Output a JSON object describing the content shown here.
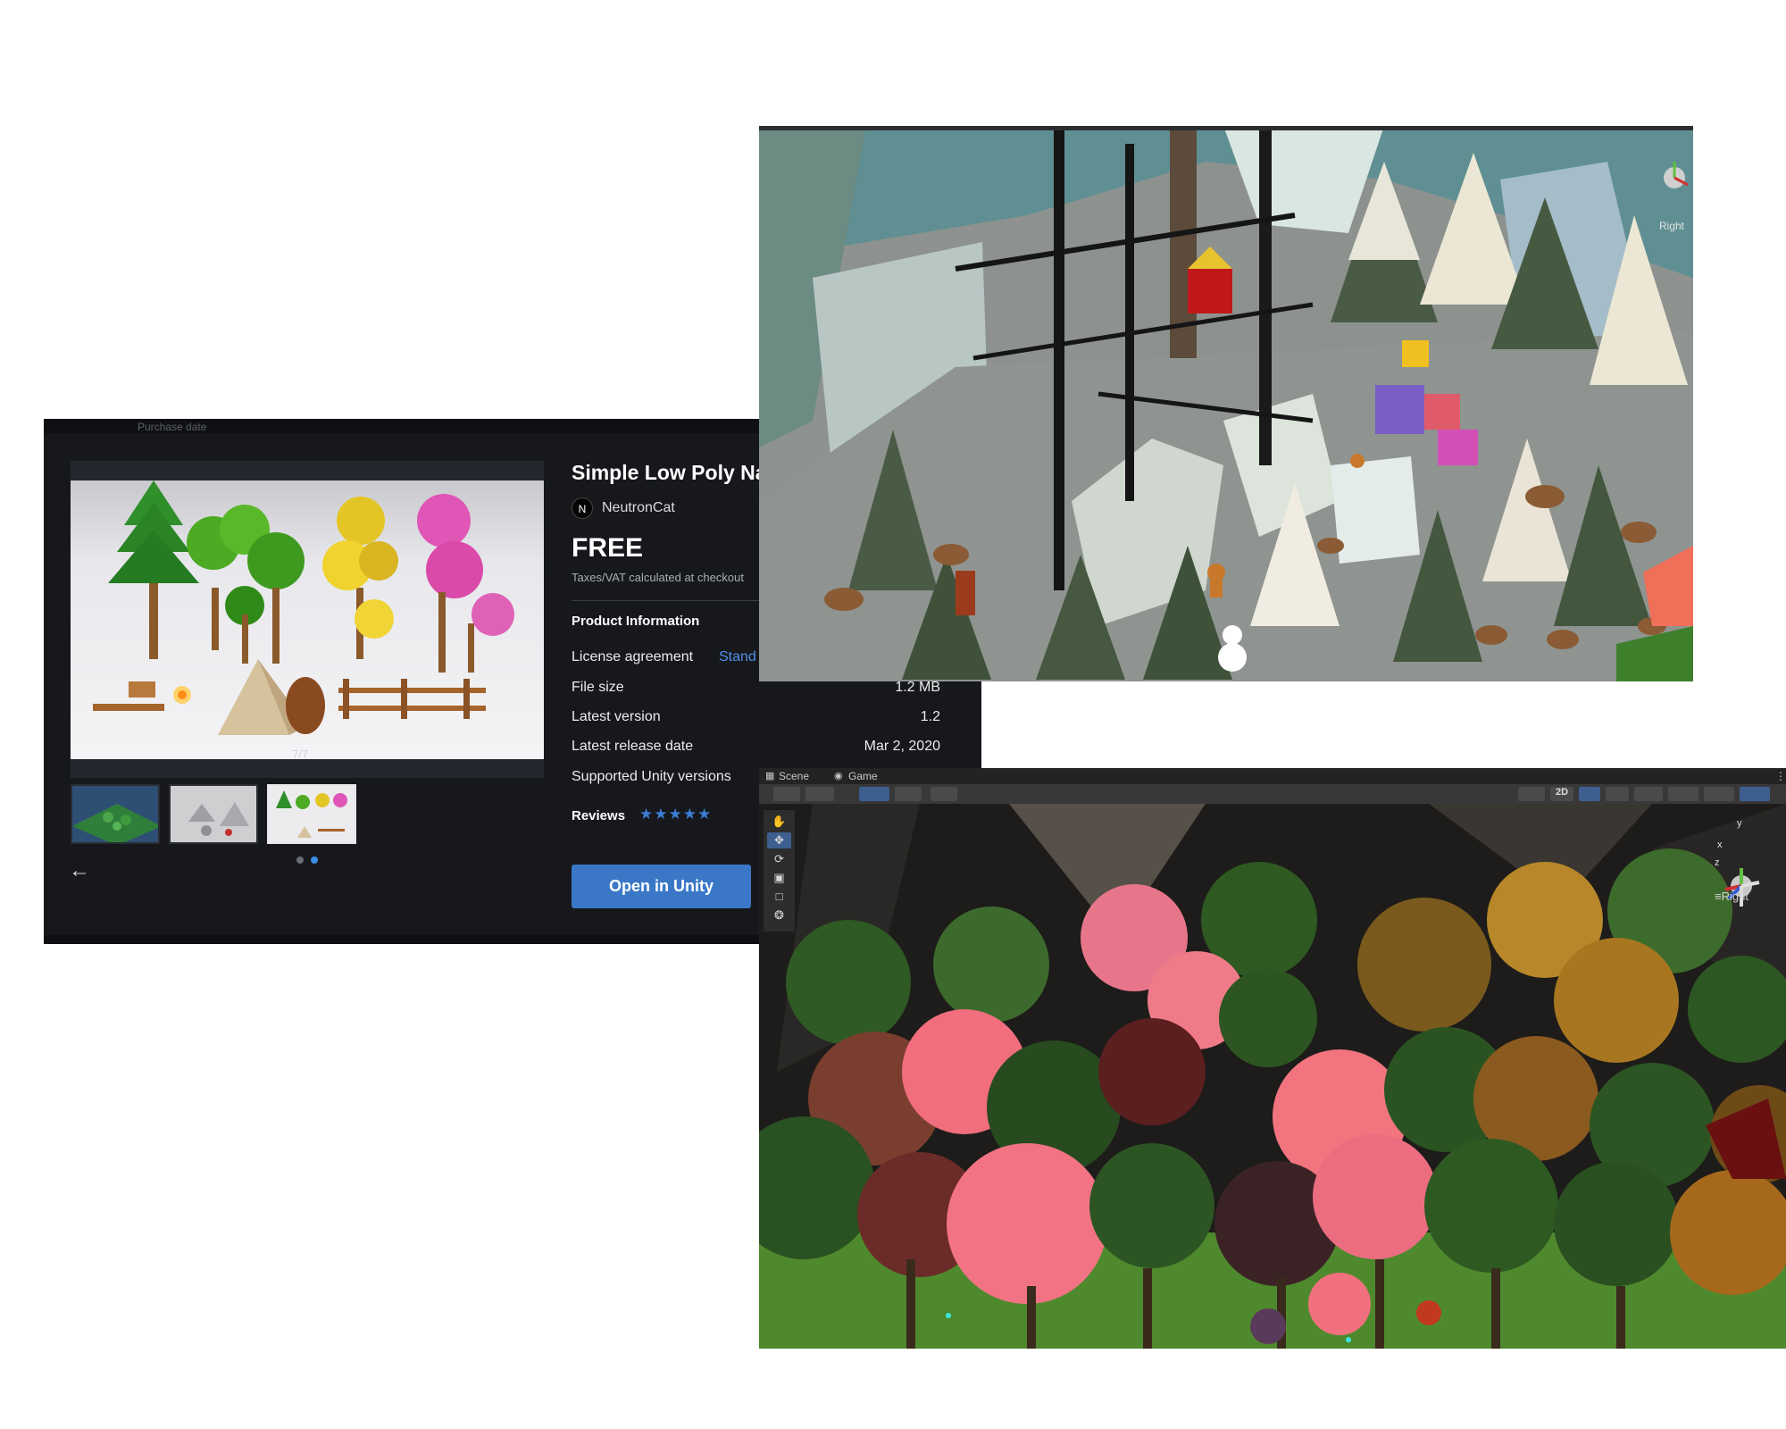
{
  "store": {
    "topbar_text": [
      "Purchase date"
    ],
    "title": "Simple Low Poly Na",
    "publisher": {
      "initial": "N",
      "name": "NeutronCat"
    },
    "price": "FREE",
    "tax_note": "Taxes/VAT calculated at checkout",
    "section_title": "Product Information",
    "info": [
      {
        "label": "License agreement",
        "value": "Stand"
      },
      {
        "label": "File size",
        "value": "1.2 MB"
      },
      {
        "label": "Latest version",
        "value": "1.2"
      },
      {
        "label": "Latest release date",
        "value": "Mar 2, 2020"
      },
      {
        "label": "Supported Unity versions",
        "value": ""
      }
    ],
    "reviews_label": "Reviews",
    "stars": "★★★★★",
    "gallery_counter": "7/7",
    "open_button": "Open in Unity",
    "back_icon": "arrow-left-icon",
    "colors": {
      "accent": "#3a78c7",
      "link": "#4f90e5",
      "panel": "#16181c"
    }
  },
  "winter": {
    "gizmo_label": "Right"
  },
  "editor": {
    "tabs": [
      {
        "label": "Scene",
        "icon": "grid-icon"
      },
      {
        "label": "Game",
        "icon": "gamepad-icon"
      }
    ],
    "toolbar": {
      "mode_2d": "2D"
    },
    "tools": [
      "hand-tool-icon",
      "move-tool-icon",
      "rotate-tool-icon",
      "scale-tool-icon",
      "rect-tool-icon",
      "transform-tool-icon"
    ],
    "gizmo_label": "Right",
    "gizmo_axes": {
      "y": "y",
      "z": "z",
      "x": "x"
    }
  }
}
